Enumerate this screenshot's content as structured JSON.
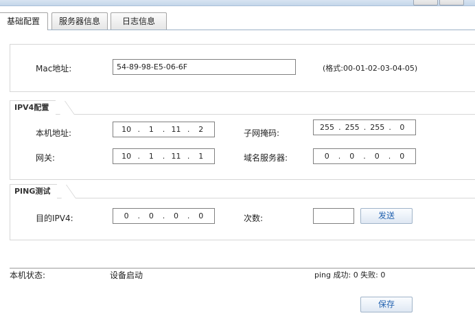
{
  "tabs": [
    {
      "label": "基础配置"
    },
    {
      "label": "服务器信息"
    },
    {
      "label": "日志信息"
    }
  ],
  "mac": {
    "label": "Mac地址:",
    "value": "54-89-98-E5-06-6F",
    "hint": "(格式:00-01-02-03-04-05)"
  },
  "ipv4": {
    "legend": "IPV4配置",
    "local_label": "本机地址:",
    "local": [
      "10",
      "1",
      "11",
      "2"
    ],
    "mask_label": "子网掩码:",
    "mask": [
      "255",
      "255",
      "255",
      "0"
    ],
    "gateway_label": "网关:",
    "gateway": [
      "10",
      "1",
      "11",
      "1"
    ],
    "dns_label": "域名服务器:",
    "dns": [
      "0",
      "0",
      "0",
      "0"
    ]
  },
  "ping": {
    "legend": "PING测试",
    "target_label": "目的IPV4:",
    "target": [
      "0",
      "0",
      "0",
      "0"
    ],
    "count_label": "次数:",
    "count_value": "",
    "send_label": "发送"
  },
  "status": {
    "label": "本机状态:",
    "value": "设备启动",
    "ping_result": "ping 成功: 0 失败: 0"
  },
  "save_label": "保存",
  "colors": {
    "accent_text": "#2463b0",
    "border": "#d6d6d6",
    "tab_line": "#9ab0c6"
  }
}
